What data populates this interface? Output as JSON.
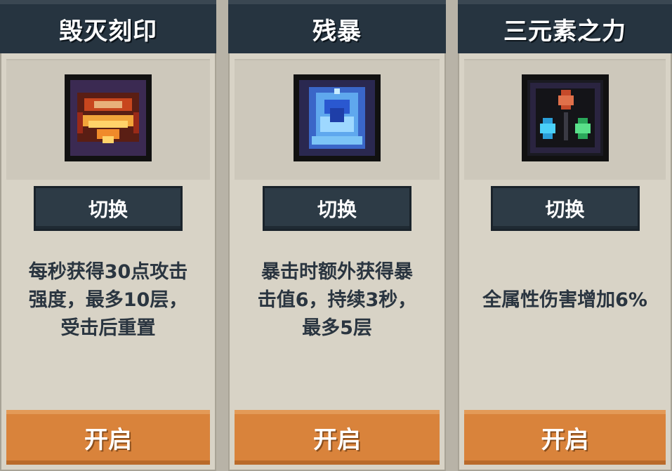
{
  "cards": [
    {
      "title": "毁灭刻印",
      "icon": "fire-mark-icon",
      "switch_label": "切换",
      "description_lines": [
        "每秒获得30点攻击",
        "强度，最多10层，",
        "受击后重置"
      ],
      "open_label": "开启"
    },
    {
      "title": "残暴",
      "icon": "ice-crystal-icon",
      "switch_label": "切换",
      "description_lines": [
        "暴击时额外获得暴",
        "击值6，持续3秒，",
        "最多5层"
      ],
      "open_label": "开启"
    },
    {
      "title": "三元素之力",
      "icon": "three-gems-icon",
      "switch_label": "切换",
      "description_lines": [
        "全属性伤害增加6%"
      ],
      "open_label": "开启"
    }
  ],
  "colors": {
    "header": "#263440",
    "card": "#d8d3c6",
    "open_button": "#d9833b",
    "text": "#2a3540"
  }
}
